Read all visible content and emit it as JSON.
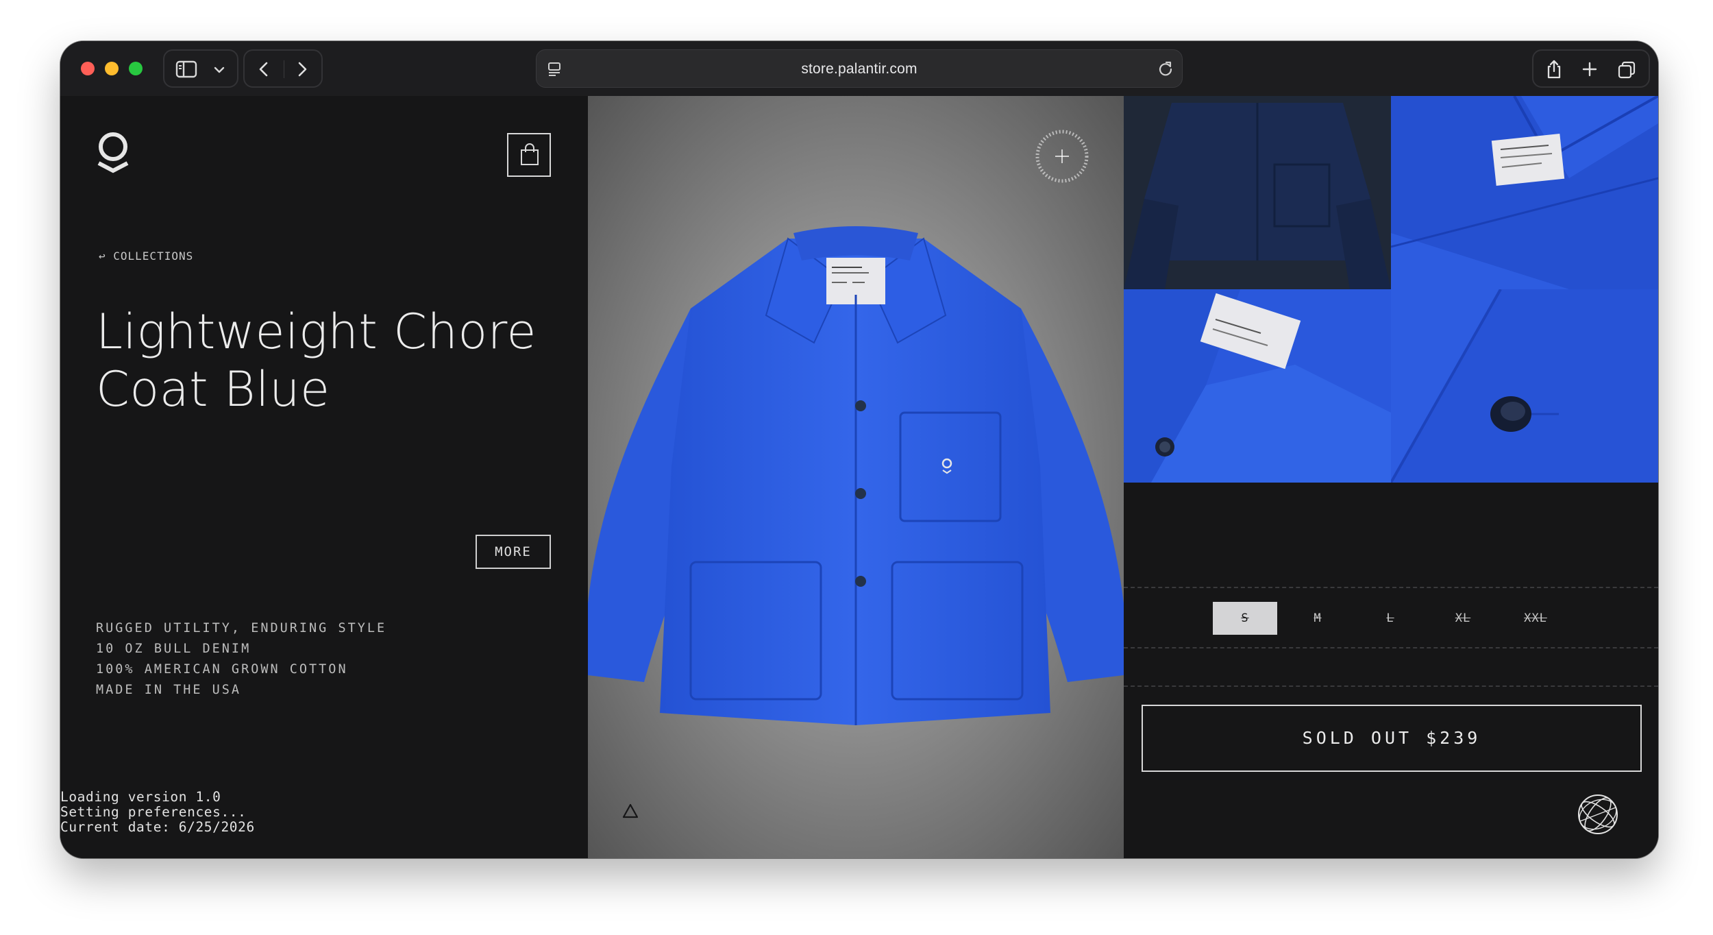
{
  "browser": {
    "url": "store.palantir.com"
  },
  "header": {
    "logo_icon": "palantir-logo-icon",
    "cart_icon": "shopping-bag-icon"
  },
  "breadcrumb": {
    "back_label": "COLLECTIONS"
  },
  "product": {
    "title_line1": "Lightweight Chore",
    "title_line2": "Coat Blue",
    "features": [
      "RUGGED UTILITY, ENDURING STYLE",
      "10 OZ BULL DENIM",
      "100% AMERICAN GROWN COTTON",
      "MADE IN THE USA"
    ],
    "more_label": "MORE",
    "sizes": [
      {
        "label": "S",
        "selected": true
      },
      {
        "label": "M",
        "selected": false
      },
      {
        "label": "L",
        "selected": false
      },
      {
        "label": "XL",
        "selected": false
      },
      {
        "label": "XXL",
        "selected": false
      }
    ],
    "buy_label": "SOLD OUT $239",
    "coat_color": "#2f5fe0"
  },
  "console": {
    "lines": [
      "Loading version 1.0",
      "Setting preferences...",
      "Current date: 6/25/2026"
    ]
  },
  "colors": {
    "background": "#161617",
    "accent_blue": "#2f5fe0",
    "selected_size_bg": "#d4d4d6"
  }
}
